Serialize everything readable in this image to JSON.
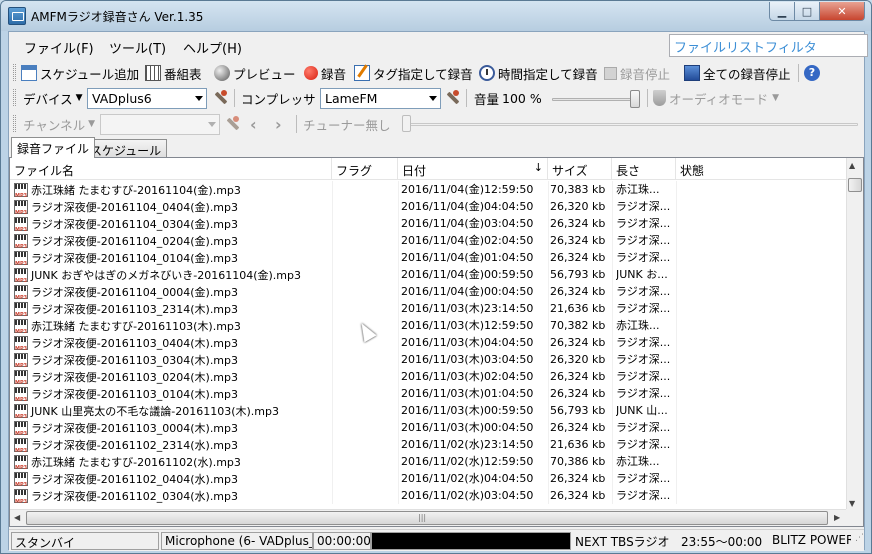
{
  "window": {
    "title": "AMFMラジオ録音さん Ver.1.35",
    "min": "▁",
    "max": "□",
    "close": "✕"
  },
  "menu": {
    "file": "ファイル(F)",
    "tools": "ツール(T)",
    "help": "ヘルプ(H)"
  },
  "filter": {
    "placeholder": "ファイルリストフィルタ"
  },
  "toolbar1": {
    "schedule_add": "スケジュール追加",
    "program_table": "番組表",
    "preview": "プレビュー",
    "record": "録音",
    "tag_record": "タグ指定して録音",
    "time_record": "時間指定して録音",
    "stop_record": "録音停止",
    "stop_all": "全ての録音停止",
    "help_glyph": "?"
  },
  "toolbar2": {
    "device_label": "デバイス",
    "device_value": "VADplus6",
    "compressor_label": "コンプレッサ",
    "compressor_value": "LameFM",
    "volume_label": "音量",
    "volume_value": "100 %",
    "volume_level": 1.0,
    "audio_mode": "オーディオモード"
  },
  "toolbar3": {
    "channel_label": "チャンネル",
    "channel_value": "",
    "tuner": "チューナー無し",
    "prev": "‹",
    "next": "›"
  },
  "tabs": {
    "files": "録音ファイル",
    "schedule": "スケジュール"
  },
  "columns": {
    "name": "ファイル名",
    "flag": "フラグ",
    "date": "日付",
    "sort": "↓",
    "size": "サイズ",
    "length": "長さ",
    "status": "状態"
  },
  "files": [
    {
      "name": "赤江珠緒 たまむすび-20161104(金).mp3",
      "flag": "",
      "date": "2016/11/04(金)12:59:50",
      "size": "70,383 kb",
      "length": "赤江珠...",
      "status": ""
    },
    {
      "name": "ラジオ深夜便-20161104_0404(金).mp3",
      "flag": "",
      "date": "2016/11/04(金)04:04:50",
      "size": "26,320 kb",
      "length": "ラジオ深...",
      "status": ""
    },
    {
      "name": "ラジオ深夜便-20161104_0304(金).mp3",
      "flag": "",
      "date": "2016/11/04(金)03:04:50",
      "size": "26,324 kb",
      "length": "ラジオ深...",
      "status": ""
    },
    {
      "name": "ラジオ深夜便-20161104_0204(金).mp3",
      "flag": "",
      "date": "2016/11/04(金)02:04:50",
      "size": "26,324 kb",
      "length": "ラジオ深...",
      "status": ""
    },
    {
      "name": "ラジオ深夜便-20161104_0104(金).mp3",
      "flag": "",
      "date": "2016/11/04(金)01:04:50",
      "size": "26,324 kb",
      "length": "ラジオ深...",
      "status": ""
    },
    {
      "name": "JUNK おぎやはぎのメガネびいき-20161104(金).mp3",
      "flag": "",
      "date": "2016/11/04(金)00:59:50",
      "size": "56,793 kb",
      "length": "JUNK お...",
      "status": ""
    },
    {
      "name": "ラジオ深夜便-20161104_0004(金).mp3",
      "flag": "",
      "date": "2016/11/04(金)00:04:50",
      "size": "26,324 kb",
      "length": "ラジオ深...",
      "status": ""
    },
    {
      "name": "ラジオ深夜便-20161103_2314(木).mp3",
      "flag": "",
      "date": "2016/11/03(木)23:14:50",
      "size": "21,636 kb",
      "length": "ラジオ深...",
      "status": ""
    },
    {
      "name": "赤江珠緒 たまむすび-20161103(木).mp3",
      "flag": "",
      "date": "2016/11/03(木)12:59:50",
      "size": "70,382 kb",
      "length": "赤江珠...",
      "status": ""
    },
    {
      "name": "ラジオ深夜便-20161103_0404(木).mp3",
      "flag": "",
      "date": "2016/11/03(木)04:04:50",
      "size": "26,324 kb",
      "length": "ラジオ深...",
      "status": ""
    },
    {
      "name": "ラジオ深夜便-20161103_0304(木).mp3",
      "flag": "",
      "date": "2016/11/03(木)03:04:50",
      "size": "26,320 kb",
      "length": "ラジオ深...",
      "status": ""
    },
    {
      "name": "ラジオ深夜便-20161103_0204(木).mp3",
      "flag": "",
      "date": "2016/11/03(木)02:04:50",
      "size": "26,324 kb",
      "length": "ラジオ深...",
      "status": ""
    },
    {
      "name": "ラジオ深夜便-20161103_0104(木).mp3",
      "flag": "",
      "date": "2016/11/03(木)01:04:50",
      "size": "26,324 kb",
      "length": "ラジオ深...",
      "status": ""
    },
    {
      "name": "JUNK 山里亮太の不毛な議論-20161103(木).mp3",
      "flag": "",
      "date": "2016/11/03(木)00:59:50",
      "size": "56,793 kb",
      "length": "JUNK 山...",
      "status": ""
    },
    {
      "name": "ラジオ深夜便-20161103_0004(木).mp3",
      "flag": "",
      "date": "2016/11/03(木)00:04:50",
      "size": "26,324 kb",
      "length": "ラジオ深...",
      "status": ""
    },
    {
      "name": "ラジオ深夜便-20161102_2314(水).mp3",
      "flag": "",
      "date": "2016/11/02(水)23:14:50",
      "size": "21,636 kb",
      "length": "ラジオ深...",
      "status": ""
    },
    {
      "name": "赤江珠緒 たまむすび-20161102(水).mp3",
      "flag": "",
      "date": "2016/11/02(水)12:59:50",
      "size": "70,386 kb",
      "length": "赤江珠...",
      "status": ""
    },
    {
      "name": "ラジオ深夜便-20161102_0404(水).mp3",
      "flag": "",
      "date": "2016/11/02(水)04:04:50",
      "size": "26,324 kb",
      "length": "ラジオ深...",
      "status": ""
    },
    {
      "name": "ラジオ深夜便-20161102_0304(水).mp3",
      "flag": "",
      "date": "2016/11/02(水)03:04:50",
      "size": "26,324 kb",
      "length": "ラジオ深...",
      "status": ""
    }
  ],
  "status": {
    "state": "スタンバイ",
    "input": "Microphone (6- VADplus_",
    "elapsed": "00:00:00",
    "next": "NEXT TBSラジオ",
    "next_time": "23:55～00:00",
    "next_program": "BLITZ POWER"
  }
}
